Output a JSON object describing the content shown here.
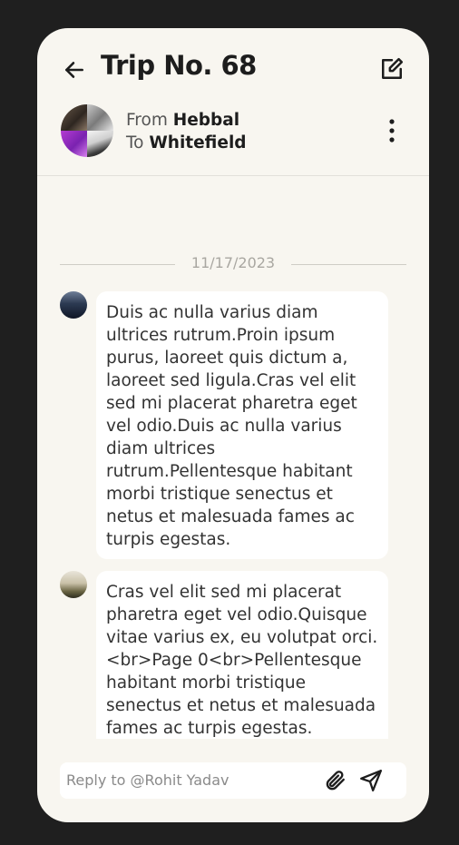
{
  "header": {
    "title": "Trip No. 68",
    "from_prefix": "From",
    "from_place": "Hebbal",
    "to_prefix": "To",
    "to_place": "Whitefield"
  },
  "icons": {
    "back": "arrow-left",
    "edit": "edit-square",
    "more": "vertical-dots",
    "attach": "paperclip",
    "send": "send-arrow"
  },
  "chat": {
    "date_divider": "11/17/2023",
    "messages": [
      {
        "text": "Duis ac nulla varius diam ultrices rutrum.Proin ipsum purus, laoreet quis dictum a, laoreet sed ligula.Cras vel elit sed mi placerat pharetra eget vel odio.Duis ac nulla varius diam ultrices rutrum.Pellentesque habitant morbi tristique senectus et netus et malesuada fames ac turpis egestas."
      },
      {
        "text": "Cras vel elit sed mi placerat pharetra eget vel odio.Quisque vitae varius ex, eu volutpat orci.<br>Page 0<br>Pellentesque habitant morbi tristique senectus et netus et malesuada fames ac turpis egestas."
      }
    ]
  },
  "reply": {
    "placeholder": "Reply to @Rohit Yadav",
    "value": ""
  },
  "colors": {
    "background": "#1f1f1f",
    "card": "#f8f6f0",
    "bubble": "#ffffff",
    "text_dark": "#1d1d1d"
  }
}
